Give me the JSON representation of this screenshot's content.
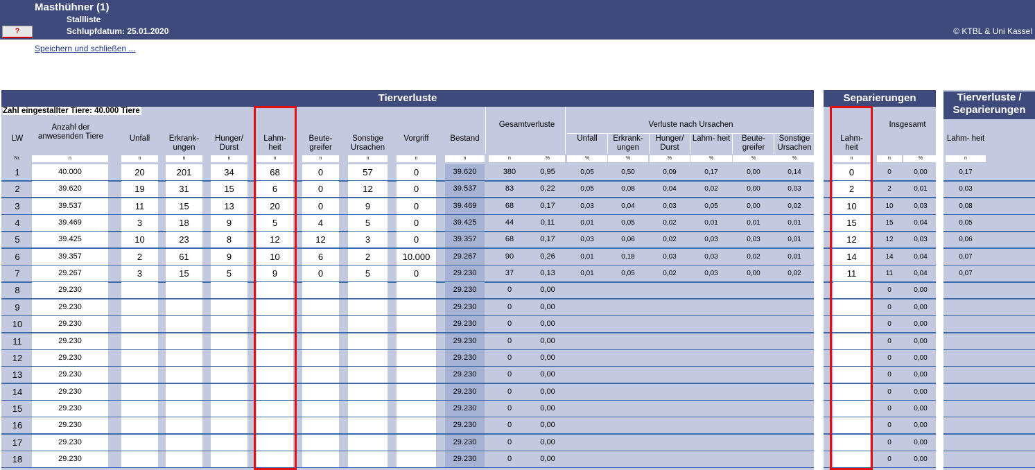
{
  "header": {
    "title": "Masthühner (1)",
    "subtitle": "Stallliste",
    "hatch_date": "Schlupfdatum: 25.01.2020",
    "help_label": "?",
    "copyright": "© KTBL & Uni Kassel"
  },
  "actions": {
    "save_close": "Speichern und schließen ..."
  },
  "sections": {
    "tierverluste": "Tierverluste",
    "separierungen": "Separierungen",
    "tv_sep": "Tierverluste / Separierungen"
  },
  "info": {
    "stocked": "Zahl eingestallter Tiere: 40.000 Tiere"
  },
  "columns": {
    "lw": "LW",
    "anzahl": "Anzahl der anwesenden Tiere",
    "unfall": "Unfall",
    "erkrankungen": "Erkrank- ungen",
    "hunger": "Hunger/ Durst",
    "lahmheit": "Lahm- heit",
    "beutegreifer": "Beute- greifer",
    "sonstige": "Sonstige Ursachen",
    "vorgriff": "Vorgriff",
    "bestand": "Bestand",
    "gesamtverluste": "Gesamtverluste",
    "verluste_ursachen": "Verluste nach Ursachen",
    "insgesamt": "Insgesamt"
  },
  "units": {
    "nr": "Nr.",
    "n": "n",
    "pct": "%"
  },
  "rows": [
    {
      "lw": "1",
      "anw": "40.000",
      "unfall": "20",
      "erkr": "201",
      "hunger": "34",
      "lahm": "68",
      "beute": "0",
      "sonst": "57",
      "vorgriff": "0",
      "bestand": "39.620",
      "gv_n": "380",
      "gv_p": "0,95",
      "u_unfall": "0,05",
      "u_erkr": "0,50",
      "u_hunger": "0,09",
      "u_lahm": "0,17",
      "u_beute": "0,00",
      "u_sonst": "0,14",
      "sep_lahm": "0",
      "ins_n": "0",
      "ins_p": "0,00",
      "tvs_lahm": "0,17"
    },
    {
      "lw": "2",
      "anw": "39.620",
      "unfall": "19",
      "erkr": "31",
      "hunger": "15",
      "lahm": "6",
      "beute": "0",
      "sonst": "12",
      "vorgriff": "0",
      "bestand": "39.537",
      "gv_n": "83",
      "gv_p": "0,22",
      "u_unfall": "0,05",
      "u_erkr": "0,08",
      "u_hunger": "0,04",
      "u_lahm": "0,02",
      "u_beute": "0,00",
      "u_sonst": "0,03",
      "sep_lahm": "2",
      "ins_n": "2",
      "ins_p": "0,01",
      "tvs_lahm": "0,03"
    },
    {
      "lw": "3",
      "anw": "39.537",
      "unfall": "11",
      "erkr": "15",
      "hunger": "13",
      "lahm": "20",
      "beute": "0",
      "sonst": "9",
      "vorgriff": "0",
      "bestand": "39.469",
      "gv_n": "68",
      "gv_p": "0,17",
      "u_unfall": "0,03",
      "u_erkr": "0,04",
      "u_hunger": "0,03",
      "u_lahm": "0,05",
      "u_beute": "0,00",
      "u_sonst": "0,02",
      "sep_lahm": "10",
      "ins_n": "10",
      "ins_p": "0,03",
      "tvs_lahm": "0,08"
    },
    {
      "lw": "4",
      "anw": "39.469",
      "unfall": "3",
      "erkr": "18",
      "hunger": "9",
      "lahm": "5",
      "beute": "4",
      "sonst": "5",
      "vorgriff": "0",
      "bestand": "39.425",
      "gv_n": "44",
      "gv_p": "0,11",
      "u_unfall": "0,01",
      "u_erkr": "0,05",
      "u_hunger": "0,02",
      "u_lahm": "0,01",
      "u_beute": "0,01",
      "u_sonst": "0,01",
      "sep_lahm": "15",
      "ins_n": "15",
      "ins_p": "0,04",
      "tvs_lahm": "0,05"
    },
    {
      "lw": "5",
      "anw": "39.425",
      "unfall": "10",
      "erkr": "23",
      "hunger": "8",
      "lahm": "12",
      "beute": "12",
      "sonst": "3",
      "vorgriff": "0",
      "bestand": "39.357",
      "gv_n": "68",
      "gv_p": "0,17",
      "u_unfall": "0,03",
      "u_erkr": "0,06",
      "u_hunger": "0,02",
      "u_lahm": "0,03",
      "u_beute": "0,03",
      "u_sonst": "0,01",
      "sep_lahm": "12",
      "ins_n": "12",
      "ins_p": "0,03",
      "tvs_lahm": "0,06"
    },
    {
      "lw": "6",
      "anw": "39.357",
      "unfall": "2",
      "erkr": "61",
      "hunger": "9",
      "lahm": "10",
      "beute": "6",
      "sonst": "2",
      "vorgriff": "10.000",
      "bestand": "29.267",
      "gv_n": "90",
      "gv_p": "0,26",
      "u_unfall": "0,01",
      "u_erkr": "0,18",
      "u_hunger": "0,03",
      "u_lahm": "0,03",
      "u_beute": "0,02",
      "u_sonst": "0,01",
      "sep_lahm": "14",
      "ins_n": "14",
      "ins_p": "0,04",
      "tvs_lahm": "0,07"
    },
    {
      "lw": "7",
      "anw": "29.267",
      "unfall": "3",
      "erkr": "15",
      "hunger": "5",
      "lahm": "9",
      "beute": "0",
      "sonst": "5",
      "vorgriff": "0",
      "bestand": "29.230",
      "gv_n": "37",
      "gv_p": "0,13",
      "u_unfall": "0,01",
      "u_erkr": "0,05",
      "u_hunger": "0,02",
      "u_lahm": "0,03",
      "u_beute": "0,00",
      "u_sonst": "0,02",
      "sep_lahm": "11",
      "ins_n": "11",
      "ins_p": "0,04",
      "tvs_lahm": "0,07"
    },
    {
      "lw": "8",
      "anw": "29.230",
      "bestand": "29.230",
      "gv_n": "0",
      "gv_p": "0,00",
      "ins_n": "0",
      "ins_p": "0,00"
    },
    {
      "lw": "9",
      "anw": "29.230",
      "bestand": "29.230",
      "gv_n": "0",
      "gv_p": "0,00",
      "ins_n": "0",
      "ins_p": "0,00"
    },
    {
      "lw": "10",
      "anw": "29.230",
      "bestand": "29.230",
      "gv_n": "0",
      "gv_p": "0,00",
      "ins_n": "0",
      "ins_p": "0,00"
    },
    {
      "lw": "11",
      "anw": "29.230",
      "bestand": "29.230",
      "gv_n": "0",
      "gv_p": "0,00",
      "ins_n": "0",
      "ins_p": "0,00"
    },
    {
      "lw": "12",
      "anw": "29.230",
      "bestand": "29.230",
      "gv_n": "0",
      "gv_p": "0,00",
      "ins_n": "0",
      "ins_p": "0,00"
    },
    {
      "lw": "13",
      "anw": "29.230",
      "bestand": "29.230",
      "gv_n": "0",
      "gv_p": "0,00",
      "ins_n": "0",
      "ins_p": "0,00"
    },
    {
      "lw": "14",
      "anw": "29.230",
      "bestand": "29.230",
      "gv_n": "0",
      "gv_p": "0,00",
      "ins_n": "0",
      "ins_p": "0,00"
    },
    {
      "lw": "15",
      "anw": "29.230",
      "bestand": "29.230",
      "gv_n": "0",
      "gv_p": "0,00",
      "ins_n": "0",
      "ins_p": "0,00"
    },
    {
      "lw": "16",
      "anw": "29.230",
      "bestand": "29.230",
      "gv_n": "0",
      "gv_p": "0,00",
      "ins_n": "0",
      "ins_p": "0,00"
    },
    {
      "lw": "17",
      "anw": "29.230",
      "bestand": "29.230",
      "gv_n": "0",
      "gv_p": "0,00",
      "ins_n": "0",
      "ins_p": "0,00"
    },
    {
      "lw": "18",
      "anw": "29.230",
      "bestand": "29.230",
      "gv_n": "0",
      "gv_p": "0,00",
      "ins_n": "0",
      "ins_p": "0,00"
    }
  ],
  "colors": {
    "header_bg": "#3d4a7b",
    "table_bg": "#c3c9de",
    "row_line": "#3a68a8",
    "bestand_bg": "#a7b3d5",
    "highlight": "#e01010"
  }
}
